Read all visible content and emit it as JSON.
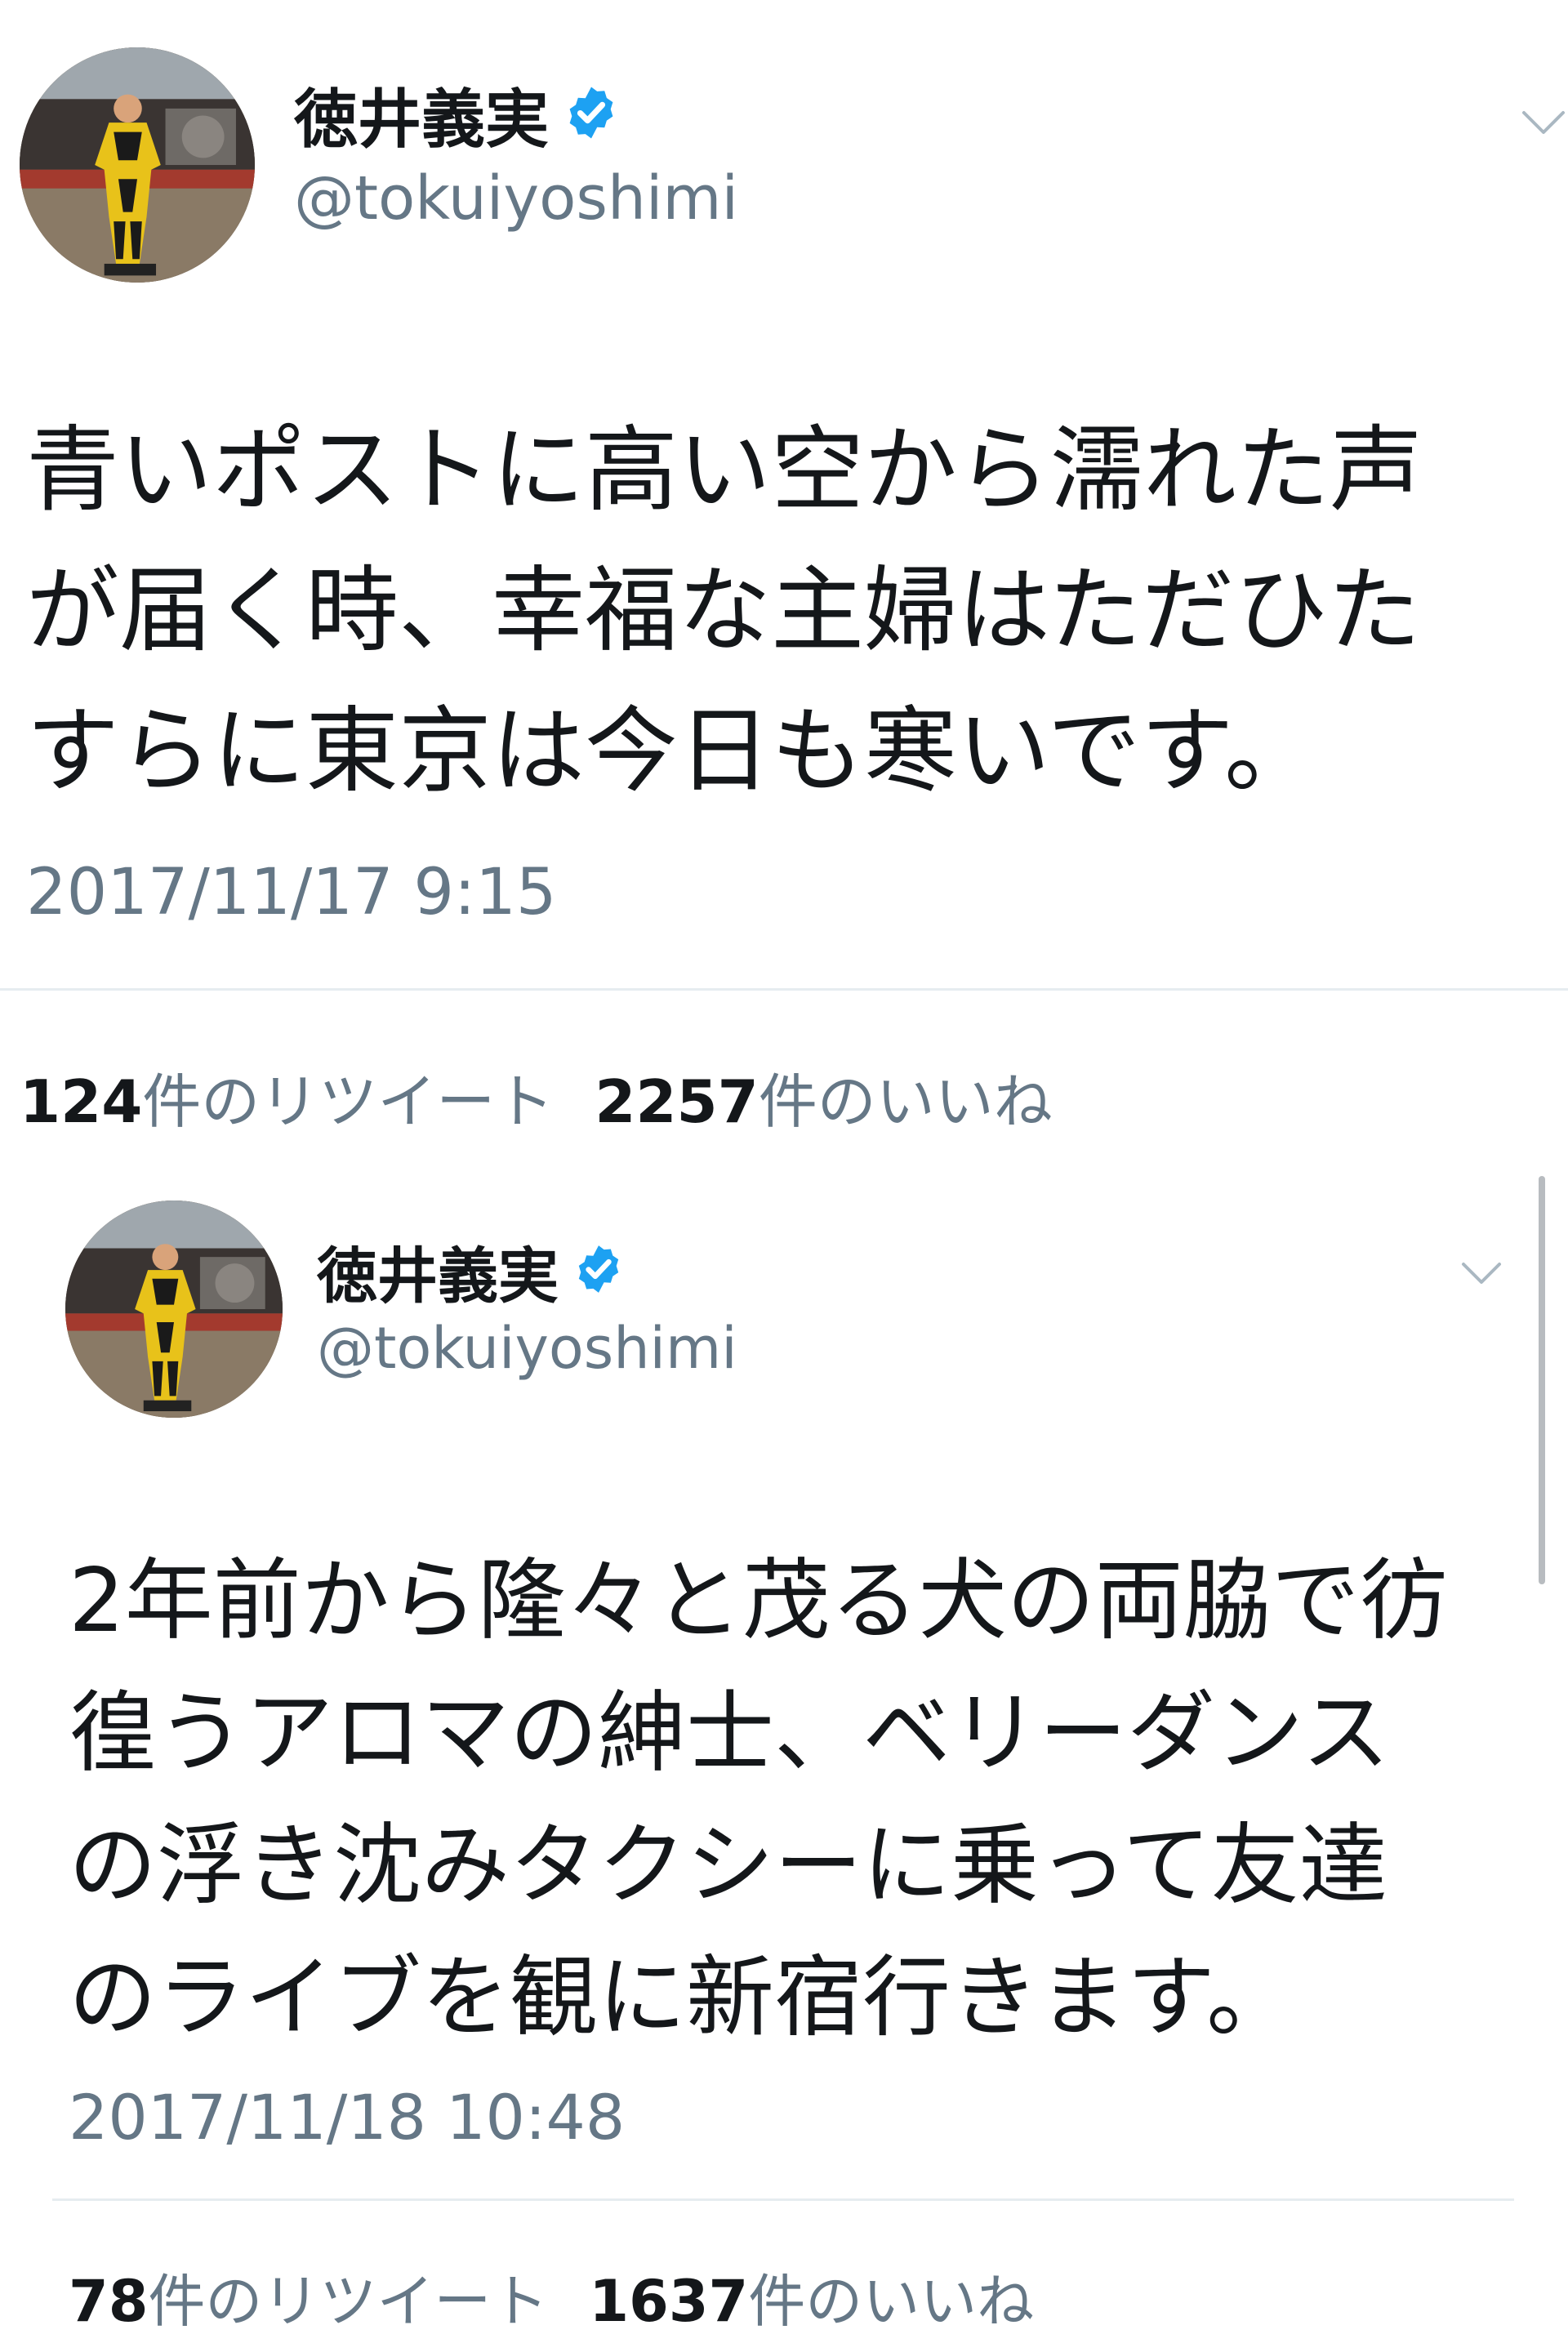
{
  "tweets": [
    {
      "display_name": "徳井義実",
      "handle": "@tokuiyoshimi",
      "text": "青いポストに高い空から濡れた声\nが届く時、幸福な主婦はただひた\nすらに東京は今日も寒いです。",
      "timestamp": "2017/11/17 9:15",
      "retweets_count": "124",
      "retweets_label": "件のリツイート",
      "likes_count": "2257",
      "likes_label": "件のいいね"
    },
    {
      "display_name": "徳井義実",
      "handle": "@tokuiyoshimi",
      "text": "2年前から隆々と茂る犬の両脇で彷\n徨うアロマの紳士、ベリーダンス\nの浮き沈みタクシーに乗って友達\nのライブを観に新宿行きます。",
      "timestamp": "2017/11/18 10:48",
      "retweets_count": "78",
      "retweets_label": "件のリツイート",
      "likes_count": "1637",
      "likes_label": "件のいいね"
    }
  ],
  "icons": {
    "verified": "verified-badge-icon",
    "caret": "chevron-down-icon"
  },
  "colors": {
    "verified_blue": "#1da1f2",
    "secondary_text": "#657786",
    "primary_text": "#14171a",
    "divider": "#e6ecf0",
    "costume_yellow": "#e8c21a"
  }
}
